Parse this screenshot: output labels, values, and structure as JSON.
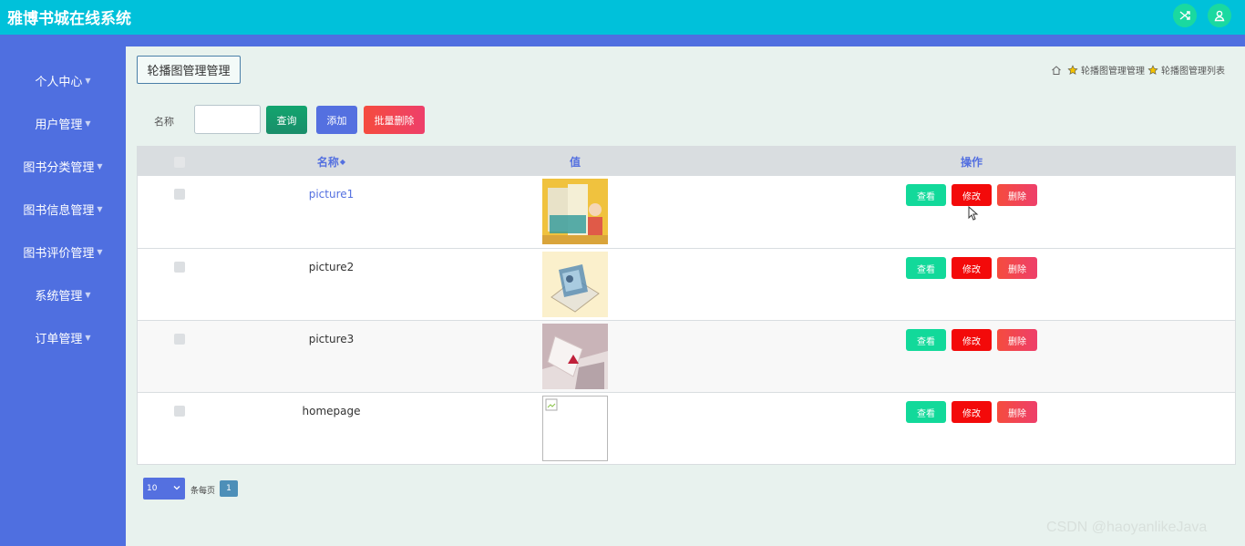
{
  "app": {
    "title": "雅博书城在线系统"
  },
  "header_icons": [
    {
      "name": "shuffle-icon"
    },
    {
      "name": "user-icon"
    }
  ],
  "sidebar": {
    "items": [
      {
        "label": "个人中心"
      },
      {
        "label": "用户管理"
      },
      {
        "label": "图书分类管理"
      },
      {
        "label": "图书信息管理"
      },
      {
        "label": "图书评价管理"
      },
      {
        "label": "系统管理"
      },
      {
        "label": "订单管理"
      }
    ]
  },
  "page": {
    "tag": "轮播图管理管理",
    "breadcrumb": [
      "轮播图管理管理",
      "轮播图管理列表"
    ]
  },
  "search": {
    "label": "名称",
    "value": "",
    "query_label": "查询",
    "add_label": "添加",
    "batch_delete_label": "批量删除"
  },
  "table": {
    "columns": {
      "name": "名称",
      "value": "值",
      "actions": "操作"
    },
    "sort_indicator": "◆",
    "rows": [
      {
        "name": "picture1",
        "image": "picture1"
      },
      {
        "name": "picture2",
        "image": "picture2"
      },
      {
        "name": "picture3",
        "image": "picture3"
      },
      {
        "name": "homepage",
        "image": "broken"
      }
    ],
    "actions": {
      "view": "查看",
      "edit": "修改",
      "delete": "删除"
    }
  },
  "pagination": {
    "page_size": "10",
    "per_page_label": "条每页",
    "current_page": "1"
  },
  "watermark": "CSDN @haoyanlikeJava",
  "colors": {
    "topbar": "#00c1da",
    "sidebar": "#4f6fe0",
    "view_btn": "#12d99a",
    "edit_btn": "#f30a0a",
    "delete_btn": "#f54c3e"
  }
}
